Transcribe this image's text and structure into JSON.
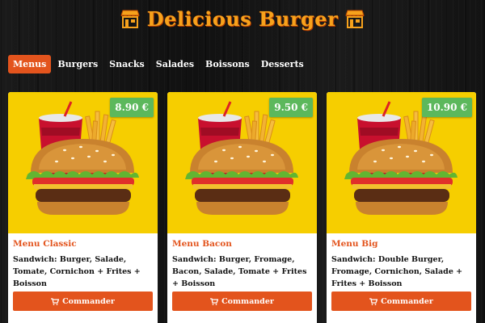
{
  "header": {
    "title": "Delicious Burger",
    "left_icon": "store-icon",
    "right_icon": "store-icon"
  },
  "nav": {
    "items": [
      {
        "label": "Menus",
        "active": true
      },
      {
        "label": "Burgers",
        "active": false
      },
      {
        "label": "Snacks",
        "active": false
      },
      {
        "label": "Salades",
        "active": false
      },
      {
        "label": "Boissons",
        "active": false
      },
      {
        "label": "Desserts",
        "active": false
      }
    ]
  },
  "cards": [
    {
      "price": "8.90 €",
      "title": "Menu Classic",
      "description": "Sandwich: Burger, Salade, Tomate, Cornichon + Frites + Boisson",
      "button_label": "Commander"
    },
    {
      "price": "9.50 €",
      "title": "Menu Bacon",
      "description": "Sandwich: Burger, Fromage, Bacon, Salade, Tomate + Frites + Boisson",
      "button_label": "Commander"
    },
    {
      "price": "10.90 €",
      "title": "Menu Big",
      "description": "Sandwich: Double Burger, Fromage, Cornichon, Salade + Frites + Boisson",
      "button_label": "Commander"
    }
  ],
  "colors": {
    "accent": "#e3541d",
    "title": "#f7a21c",
    "price_badge": "#5cb85c",
    "card_image_bg": "#f6ce00",
    "background": "#151515"
  },
  "icons": {
    "button": "cart-icon"
  }
}
